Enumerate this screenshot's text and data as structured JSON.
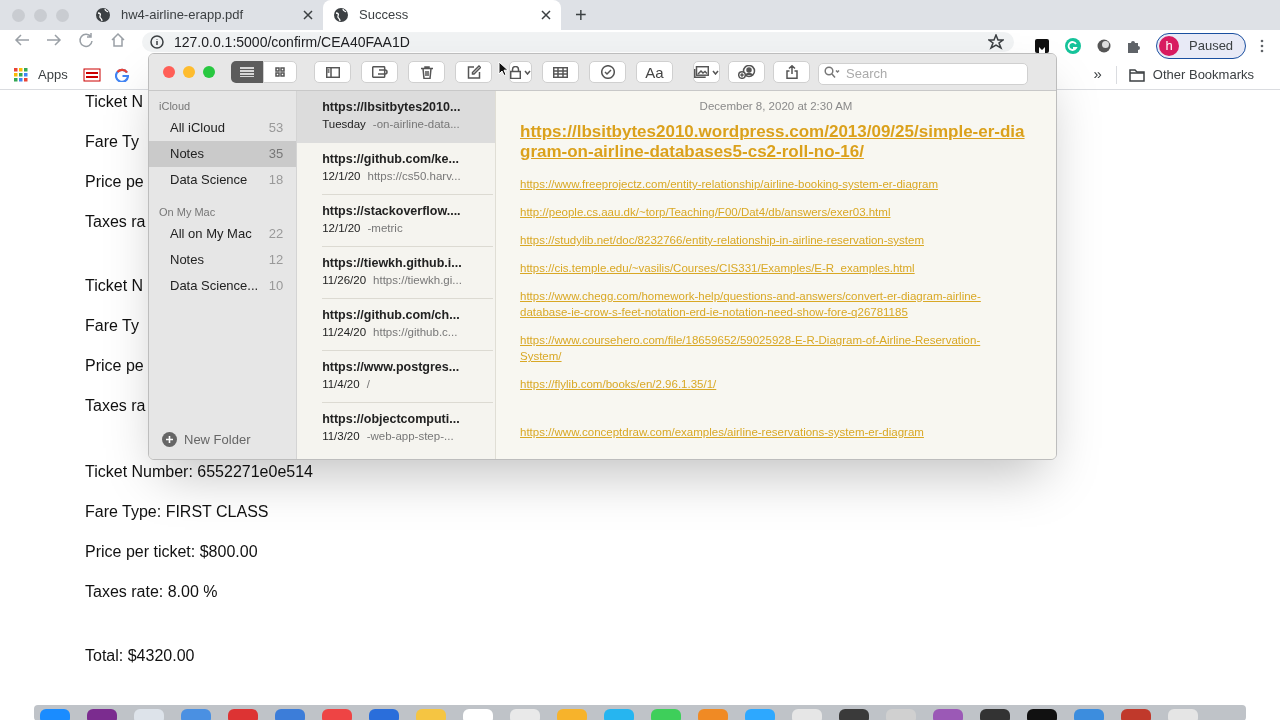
{
  "browser": {
    "tabs": [
      {
        "title": "hw4-airline-erapp.pdf",
        "selected": false
      },
      {
        "title": "Success",
        "selected": true
      }
    ],
    "new_tab": "+",
    "url": "127.0.0.1:5000/confirm/CEA40FAA1D",
    "profile": {
      "initial": "h",
      "status": "Paused"
    },
    "bookmarks": {
      "apps": "Apps",
      "overflow": "»",
      "other": "Other Bookmarks"
    }
  },
  "page": {
    "covered_lines": [
      "Ticket N",
      "Fare Ty",
      "Price pe",
      "Taxes ra",
      "Ticket N",
      "Fare Ty",
      "Price pe",
      "Taxes ra"
    ],
    "lines": [
      "Ticket Number: 6552271e0e514",
      "Fare Type: FIRST CLASS",
      "Price per ticket: $800.00",
      "Taxes rate: 8.00 %"
    ],
    "total": "Total: $4320.00"
  },
  "notes": {
    "search_placeholder": "Search",
    "format_label": "Aa",
    "sections": [
      {
        "heading": "iCloud",
        "folders": [
          {
            "name": "All iCloud",
            "count": "53",
            "selected": false
          },
          {
            "name": "Notes",
            "count": "35",
            "selected": true
          },
          {
            "name": "Data Science",
            "count": "18",
            "selected": false
          }
        ]
      },
      {
        "heading": "On My Mac",
        "folders": [
          {
            "name": "All on My Mac",
            "count": "22",
            "selected": false
          },
          {
            "name": "Notes",
            "count": "12",
            "selected": false
          },
          {
            "name": "Data Science...",
            "count": "10",
            "selected": false
          }
        ]
      }
    ],
    "new_folder": "New Folder",
    "list": [
      {
        "title": "https://lbsitbytes2010...",
        "date": "Tuesday",
        "preview": "-on-airline-data...",
        "selected": true
      },
      {
        "title": "https://github.com/ke...",
        "date": "12/1/20",
        "preview": "https://cs50.harv...",
        "selected": false
      },
      {
        "title": "https://stackoverflow....",
        "date": "12/1/20",
        "preview": "-metric",
        "selected": false
      },
      {
        "title": "https://tiewkh.github.i...",
        "date": "11/26/20",
        "preview": "https://tiewkh.gi...",
        "selected": false
      },
      {
        "title": "https://github.com/ch...",
        "date": "11/24/20",
        "preview": "https://github.c...",
        "selected": false
      },
      {
        "title": "https://www.postgres...",
        "date": "11/4/20",
        "preview": "/",
        "selected": false
      },
      {
        "title": "https://objectcomputi...",
        "date": "11/3/20",
        "preview": "-web-app-step-...",
        "selected": false
      }
    ],
    "note": {
      "date": "December 8, 2020 at 2:30 AM",
      "title": "https://lbsitbytes2010.wordpress.com/2013/09/25/simple-er-diagram-on-airline-databases5-cs2-roll-no-16/",
      "links": [
        "https://www.freeprojectz.com/entity-relationship/airline-booking-system-er-diagram",
        "http://people.cs.aau.dk/~torp/Teaching/F00/Dat4/db/answers/exer03.html",
        "https://studylib.net/doc/8232766/entity-relationship-in-airline-reservation-system",
        "https://cis.temple.edu/~vasilis/Courses/CIS331/Examples/E-R_examples.html",
        "https://www.chegg.com/homework-help/questions-and-answers/convert-er-diagram-airline-database-ie-crow-s-feet-notation-erd-ie-notation-need-show-fore-q26781185",
        "https://www.coursehero.com/file/18659652/59025928-E-R-Diagram-of-Airline-Reservation-System/",
        "https://flylib.com/books/en/2.96.1.35/1/",
        "https://www.conceptdraw.com/examples/airline-reservations-system-er-diagram"
      ]
    }
  }
}
